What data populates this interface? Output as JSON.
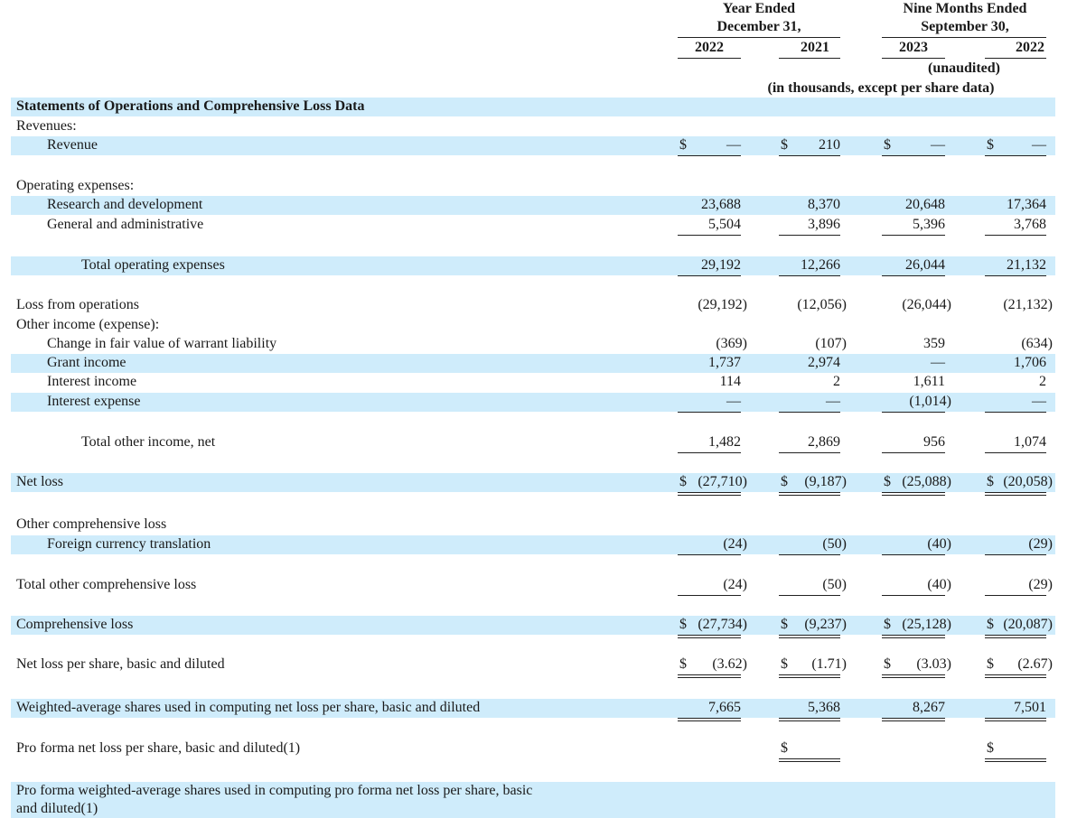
{
  "header": {
    "group1_title": [
      "Year Ended",
      "December 31,"
    ],
    "group2_title": [
      "Nine Months Ended",
      "September 30,"
    ],
    "years": [
      "2022",
      "2021",
      "2023",
      "2022"
    ],
    "unaudited": "(unaudited)",
    "units": "(in thousands, except per share data)"
  },
  "rows": [
    {
      "label": "Statements of Operations and Comprehensive Loss Data",
      "bold": true,
      "stripe": true
    },
    {
      "label": "Revenues:"
    },
    {
      "label": "Revenue",
      "indent": 1,
      "stripe": true,
      "dollar": true,
      "values": [
        "—",
        "210",
        "—",
        "—"
      ],
      "rule": "single"
    },
    {
      "label": "Operating expenses:"
    },
    {
      "label": "Research and development",
      "indent": 1,
      "stripe": true,
      "values": [
        "23,688",
        "8,370",
        "20,648",
        "17,364"
      ]
    },
    {
      "label": "General and administrative",
      "indent": 1,
      "values": [
        "5,504",
        "3,896",
        "5,396",
        "3,768"
      ],
      "rule": "single"
    },
    {
      "label": "Total operating expenses",
      "indent": 2,
      "stripe": true,
      "values": [
        "29,192",
        "12,266",
        "26,044",
        "21,132"
      ],
      "rule": "single"
    },
    {
      "label": "Loss from operations",
      "values": [
        "(29,192)",
        "(12,056)",
        "(26,044)",
        "(21,132)"
      ]
    },
    {
      "label": "Other income (expense):"
    },
    {
      "label": "Change in fair value of warrant liability",
      "indent": 1,
      "values": [
        "(369)",
        "(107)",
        "359",
        "(634)"
      ]
    },
    {
      "label": "Grant income",
      "indent": 1,
      "stripe": true,
      "values": [
        "1,737",
        "2,974",
        "—",
        "1,706"
      ]
    },
    {
      "label": "Interest income",
      "indent": 1,
      "values": [
        "114",
        "2",
        "1,611",
        "2"
      ]
    },
    {
      "label": "Interest expense",
      "indent": 1,
      "stripe": true,
      "values": [
        "—",
        "—",
        "(1,014)",
        "—"
      ],
      "rule": "single"
    },
    {
      "label": "Total other income, net",
      "indent": 2,
      "values": [
        "1,482",
        "2,869",
        "956",
        "1,074"
      ],
      "rule": "single"
    },
    {
      "label": "Net loss",
      "stripe": true,
      "dollar": true,
      "values": [
        "(27,710)",
        "(9,187)",
        "(25,088)",
        "(20,058)"
      ],
      "rule": "double"
    },
    {
      "label": "Other comprehensive loss"
    },
    {
      "label": "Foreign currency translation",
      "indent": 1,
      "stripe": true,
      "values": [
        "(24)",
        "(50)",
        "(40)",
        "(29)"
      ],
      "rule": "single"
    },
    {
      "label": "Total other comprehensive loss",
      "values": [
        "(24)",
        "(50)",
        "(40)",
        "(29)"
      ],
      "rule": "single"
    },
    {
      "label": "Comprehensive loss",
      "stripe": true,
      "dollar": true,
      "values": [
        "(27,734)",
        "(9,237)",
        "(25,128)",
        "(20,087)"
      ],
      "rule": "double"
    },
    {
      "label": "Net loss per share, basic and diluted",
      "dollar": true,
      "values": [
        "(3.62)",
        "(1.71)",
        "(3.03)",
        "(2.67)"
      ],
      "rule": "double"
    },
    {
      "label": "Weighted-average shares used in computing net loss per share, basic and diluted",
      "stripe": true,
      "values": [
        "7,665",
        "5,368",
        "8,267",
        "7,501"
      ],
      "rule": "double"
    },
    {
      "label": "Pro forma net loss per share, basic and diluted(1)",
      "dollar": true,
      "values": [
        "",
        "",
        "",
        ""
      ],
      "only": [
        1,
        3
      ],
      "rule": "double"
    },
    {
      "label": "Pro forma weighted-average shares used in computing pro forma net loss per share, basic",
      "stripe": true,
      "wrap_tail": "and diluted(1)"
    }
  ],
  "currency_symbol": "$",
  "colors": {
    "stripe": "#cfecfb",
    "text": "#1a1a1a",
    "rule": "#222222"
  }
}
